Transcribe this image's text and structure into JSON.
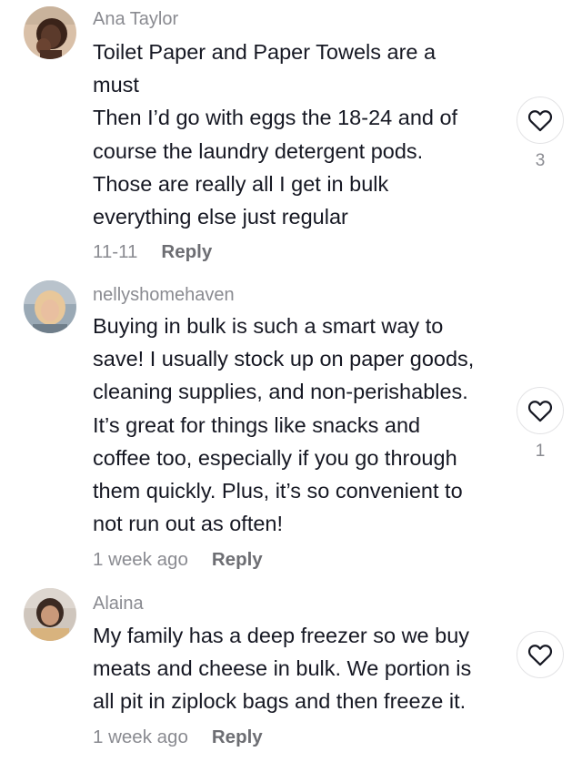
{
  "comments": [
    {
      "username": "Ana Taylor",
      "lines": [
        "Toilet Paper and Paper Towels are a",
        "must",
        "Then I’d go with eggs the 18-24 and of",
        "course the laundry detergent pods.",
        "Those are really all I get in bulk",
        "everything else just regular"
      ],
      "date": "11-11",
      "reply": "Reply",
      "likes": "3",
      "avatar_icon": "user-avatar",
      "avatar_colors": [
        "#d9c0a8",
        "#4a2e22"
      ]
    },
    {
      "username": "nellyshomehaven",
      "lines": [
        "Buying in bulk is such a smart way to",
        "save! I usually stock up on paper goods,",
        "cleaning supplies, and non-perishables.",
        "It’s great for things like snacks and",
        "coffee too, especially if you go through",
        "them quickly. Plus, it’s so convenient to",
        "not run out as often!"
      ],
      "date": "1 week ago",
      "reply": "Reply",
      "likes": "1",
      "avatar_icon": "user-avatar",
      "avatar_colors": [
        "#9aa9b5",
        "#e8c79a"
      ]
    },
    {
      "username": "Alaina",
      "lines": [
        "My family has a deep freezer so we buy",
        "meats and cheese in bulk. We portion is",
        "all pit in ziplock bags and then freeze it."
      ],
      "date": "1 week ago",
      "reply": "Reply",
      "likes": "",
      "avatar_icon": "user-avatar",
      "avatar_colors": [
        "#cfc6bd",
        "#3b2a22"
      ]
    }
  ],
  "icons": {
    "like": "heart-outline-icon"
  },
  "colors": {
    "text": "#161823",
    "muted": "#8a8b91",
    "reply": "#6d6e73",
    "like_border": "#e3e3e5"
  }
}
